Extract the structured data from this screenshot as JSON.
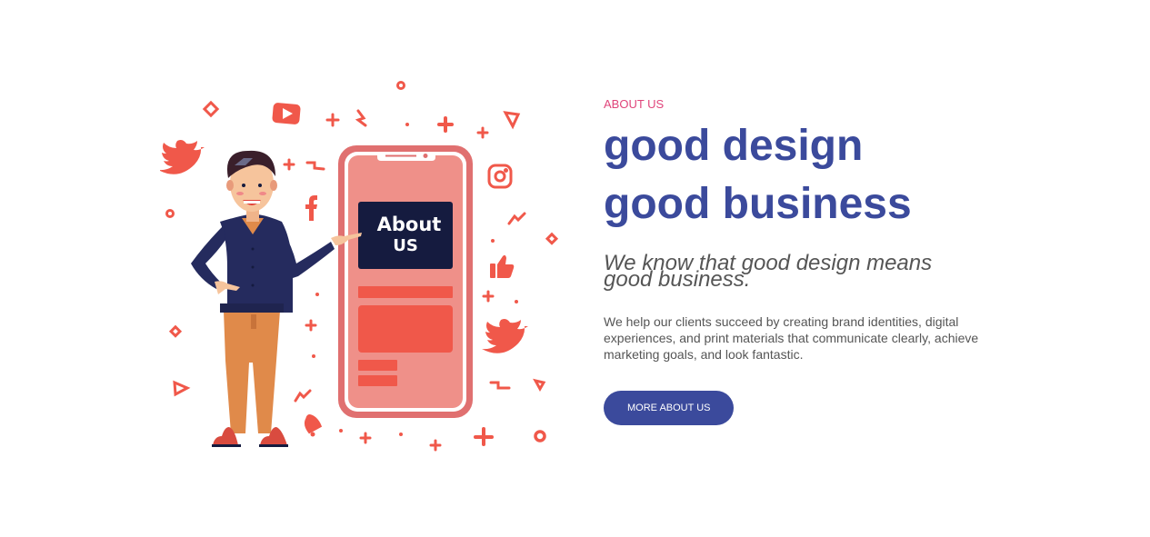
{
  "about_section": {
    "eyebrow": "ABOUT US",
    "headline_line1": "good design",
    "headline_line2": "good business",
    "tagline": "We know that good design means good business.",
    "body": "We help our clients succeed by creating brand identities, digital experiences, and print materials that communicate clearly, achieve marketing goals, and look fantastic.",
    "cta_label": "MORE ABOUT US"
  },
  "illustration": {
    "phone_screen_line1": "About",
    "phone_screen_line2": "US"
  },
  "colors": {
    "accent_pink": "#e0457b",
    "brand_blue": "#3b4a9c",
    "text_gray": "#555555",
    "illustration_coral": "#f0584a",
    "phone_body": "#e07070",
    "phone_screen": "#ef9089",
    "navy": "#151b3f"
  }
}
